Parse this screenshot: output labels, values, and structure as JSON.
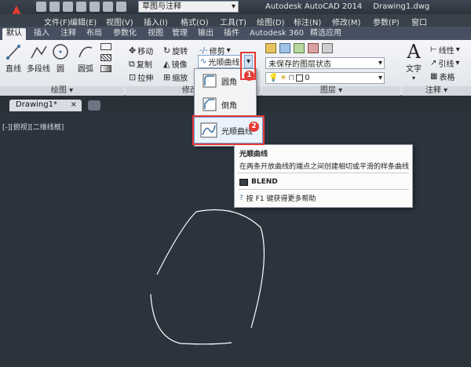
{
  "app": {
    "workspace": "草图与注释",
    "title": "Autodesk AutoCAD 2014",
    "drawing_name": "Drawing1.dwg"
  },
  "menu": [
    "文件(F)",
    "编辑(E)",
    "视图(V)",
    "插入(I)",
    "格式(O)",
    "工具(T)",
    "绘图(D)",
    "标注(N)",
    "修改(M)",
    "参数(P)",
    "窗口"
  ],
  "tabs": [
    "默认",
    "插入",
    "注释",
    "布局",
    "参数化",
    "视图",
    "管理",
    "输出",
    "插件",
    "Autodesk 360",
    "精选应用"
  ],
  "draw": {
    "line": "直线",
    "polyline": "多段线",
    "circle": "圆",
    "arc": "圆弧",
    "panel": "绘图"
  },
  "modify": {
    "move": "移动",
    "rotate": "旋转",
    "trim": "修剪",
    "copy": "复制",
    "mirror": "镜像",
    "blend": "光顺曲线",
    "stretch": "拉伸",
    "scale": "缩放",
    "panel": "修改"
  },
  "layers": {
    "state": "未保存的图层状态",
    "current": "0",
    "panel": "图层"
  },
  "annotation": {
    "text": "文字",
    "linear": "线性",
    "leader": "引线",
    "table": "表格",
    "panel": "注释"
  },
  "dropdown": {
    "fillet": "圆角",
    "chamfer": "倒角",
    "blend": "光顺曲线"
  },
  "doc_tab": "Drawing1*",
  "viewport_label": "[-][俯视][二维线框]",
  "tooltip": {
    "title": "光顺曲线",
    "desc": "在两条开放曲线的端点之间创建相切或平滑的样条曲线",
    "command": "BLEND",
    "help": "按 F1 键获得更多帮助"
  },
  "badges": [
    "1",
    "2"
  ],
  "colors": {
    "accent_red": "#e53935",
    "canvas": "#2b333d"
  }
}
